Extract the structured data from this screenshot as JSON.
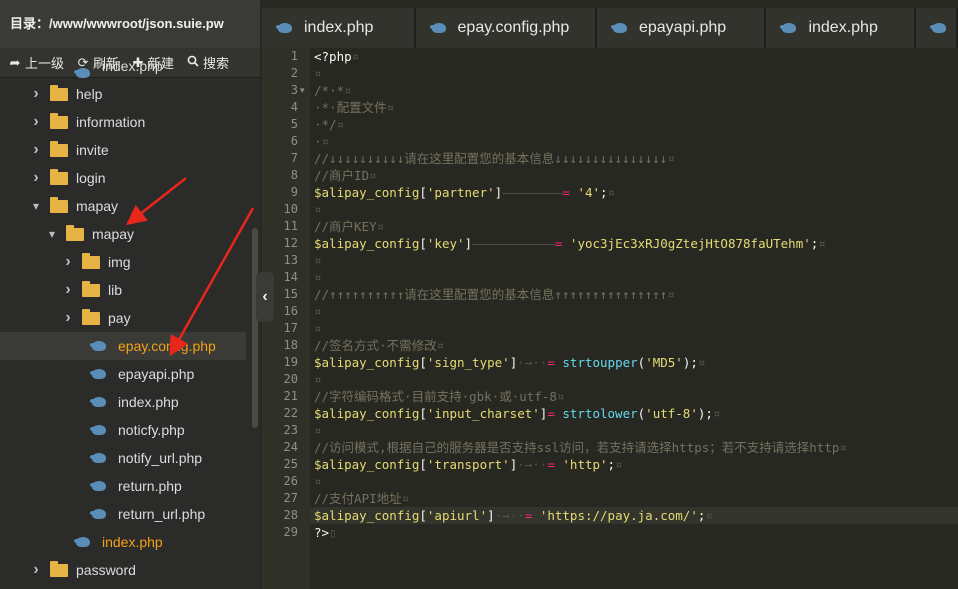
{
  "sidebar": {
    "title": "目录：/www/wwwroot/json.suie.pw",
    "toolbar": [
      {
        "label": "上一级",
        "icon": "arrow-up-icon"
      },
      {
        "label": "刷新",
        "icon": "refresh-icon"
      },
      {
        "label": "新建",
        "icon": "plus-icon"
      },
      {
        "label": "搜索",
        "icon": "search-icon"
      }
    ],
    "tree": [
      {
        "label": "index.php",
        "type": "file",
        "depth": 1,
        "state": "none"
      },
      {
        "label": "help",
        "type": "folder",
        "depth": 0,
        "state": "collapsed"
      },
      {
        "label": "information",
        "type": "folder",
        "depth": 0,
        "state": "collapsed"
      },
      {
        "label": "invite",
        "type": "folder",
        "depth": 0,
        "state": "collapsed"
      },
      {
        "label": "login",
        "type": "folder",
        "depth": 0,
        "state": "collapsed"
      },
      {
        "label": "mapay",
        "type": "folder",
        "depth": 0,
        "state": "expanded"
      },
      {
        "label": "mapay",
        "type": "folder",
        "depth": 1,
        "state": "expanded"
      },
      {
        "label": "img",
        "type": "folder",
        "depth": 2,
        "state": "collapsed"
      },
      {
        "label": "lib",
        "type": "folder",
        "depth": 2,
        "state": "collapsed"
      },
      {
        "label": "pay",
        "type": "folder",
        "depth": 2,
        "state": "collapsed"
      },
      {
        "label": "epay.config.php",
        "type": "file",
        "depth": 2,
        "state": "selected"
      },
      {
        "label": "epayapi.php",
        "type": "file",
        "depth": 2,
        "state": "none"
      },
      {
        "label": "index.php",
        "type": "file",
        "depth": 2,
        "state": "none"
      },
      {
        "label": "noticfy.php",
        "type": "file",
        "depth": 2,
        "state": "none"
      },
      {
        "label": "notify_url.php",
        "type": "file",
        "depth": 2,
        "state": "none"
      },
      {
        "label": "return.php",
        "type": "file",
        "depth": 2,
        "state": "none"
      },
      {
        "label": "return_url.php",
        "type": "file",
        "depth": 2,
        "state": "none"
      },
      {
        "label": "index.php",
        "type": "file",
        "depth": 1,
        "state": "active"
      },
      {
        "label": "password",
        "type": "folder",
        "depth": 0,
        "state": "collapsed"
      }
    ],
    "collapse_glyph": "‹"
  },
  "tabs": [
    {
      "label": "index.php"
    },
    {
      "label": "epay.config.php"
    },
    {
      "label": "epayapi.php"
    },
    {
      "label": "index.php"
    },
    {
      "label": ""
    }
  ],
  "editor": {
    "active_line": 28,
    "lines": [
      [
        [
          "kw",
          "<?php"
        ],
        [
          "inv",
          "¤"
        ]
      ],
      [
        [
          "inv",
          "¤"
        ]
      ],
      [
        [
          "cm",
          "/*·*"
        ],
        [
          "inv",
          "¤"
        ]
      ],
      [
        [
          "cm",
          "·*·配置文件"
        ],
        [
          "inv",
          "¤"
        ]
      ],
      [
        [
          "cm",
          "·*/"
        ],
        [
          "inv",
          "¤"
        ]
      ],
      [
        [
          "cm",
          "·"
        ],
        [
          "inv",
          "¤"
        ]
      ],
      [
        [
          "cm",
          "//↓↓↓↓↓↓↓↓↓↓请在这里配置您的基本信息↓↓↓↓↓↓↓↓↓↓↓↓↓↓↓"
        ],
        [
          "inv",
          "¤"
        ]
      ],
      [
        [
          "cm",
          "//商户ID"
        ],
        [
          "inv",
          "¤"
        ]
      ],
      [
        [
          "var",
          "$alipay_config"
        ],
        [
          "pun",
          "["
        ],
        [
          "str",
          "'partner'"
        ],
        [
          "pun",
          "]"
        ],
        [
          "inv",
          "————————"
        ],
        [
          "op",
          "="
        ],
        [
          "pun",
          " "
        ],
        [
          "str",
          "'4'"
        ],
        [
          "pun",
          ";"
        ],
        [
          "inv",
          "¤"
        ]
      ],
      [
        [
          "inv",
          "¤"
        ]
      ],
      [
        [
          "cm",
          "//商户KEY"
        ],
        [
          "inv",
          "¤"
        ]
      ],
      [
        [
          "var",
          "$alipay_config"
        ],
        [
          "pun",
          "["
        ],
        [
          "str",
          "'key'"
        ],
        [
          "pun",
          "]"
        ],
        [
          "inv",
          "———————————"
        ],
        [
          "op",
          "="
        ],
        [
          "pun",
          " "
        ],
        [
          "str",
          "'yoc3jEc3xRJ0gZtejHtO878faUTehm'"
        ],
        [
          "pun",
          ";"
        ],
        [
          "inv",
          "¤"
        ]
      ],
      [
        [
          "inv",
          "¤"
        ]
      ],
      [
        [
          "inv",
          "¤"
        ]
      ],
      [
        [
          "cm",
          "//↑↑↑↑↑↑↑↑↑↑请在这里配置您的基本信息↑↑↑↑↑↑↑↑↑↑↑↑↑↑↑"
        ],
        [
          "inv",
          "¤"
        ]
      ],
      [
        [
          "inv",
          "¤"
        ]
      ],
      [
        [
          "inv",
          "¤"
        ]
      ],
      [
        [
          "cm",
          "//签名方式·不需修改"
        ],
        [
          "inv",
          "¤"
        ]
      ],
      [
        [
          "var",
          "$alipay_config"
        ],
        [
          "pun",
          "["
        ],
        [
          "str",
          "'sign_type'"
        ],
        [
          "pun",
          "]"
        ],
        [
          "inv",
          "·→··"
        ],
        [
          "op",
          "="
        ],
        [
          "pun",
          " "
        ],
        [
          "fn",
          "strtoupper"
        ],
        [
          "pun",
          "("
        ],
        [
          "str",
          "'MD5'"
        ],
        [
          "pun",
          ");"
        ],
        [
          "inv",
          "¤"
        ]
      ],
      [
        [
          "inv",
          "¤"
        ]
      ],
      [
        [
          "cm",
          "//字符编码格式·目前支持·gbk·或·utf-8"
        ],
        [
          "inv",
          "¤"
        ]
      ],
      [
        [
          "var",
          "$alipay_config"
        ],
        [
          "pun",
          "["
        ],
        [
          "str",
          "'input_charset'"
        ],
        [
          "pun",
          "]"
        ],
        [
          "op",
          "="
        ],
        [
          "pun",
          " "
        ],
        [
          "fn",
          "strtolower"
        ],
        [
          "pun",
          "("
        ],
        [
          "str",
          "'utf-8'"
        ],
        [
          "pun",
          ");"
        ],
        [
          "inv",
          "¤"
        ]
      ],
      [
        [
          "inv",
          "¤"
        ]
      ],
      [
        [
          "cm",
          "//访问模式,根据自己的服务器是否支持ssl访问，若支持请选择https；若不支持请选择http"
        ],
        [
          "inv",
          "¤"
        ]
      ],
      [
        [
          "var",
          "$alipay_config"
        ],
        [
          "pun",
          "["
        ],
        [
          "str",
          "'transport'"
        ],
        [
          "pun",
          "]"
        ],
        [
          "inv",
          "·→··"
        ],
        [
          "op",
          "="
        ],
        [
          "pun",
          " "
        ],
        [
          "str",
          "'http'"
        ],
        [
          "pun",
          ";"
        ],
        [
          "inv",
          "¤"
        ]
      ],
      [
        [
          "inv",
          "¤"
        ]
      ],
      [
        [
          "cm",
          "//支付API地址"
        ],
        [
          "inv",
          "¤"
        ]
      ],
      [
        [
          "var",
          "$alipay_config"
        ],
        [
          "pun",
          "["
        ],
        [
          "str",
          "'apiurl'"
        ],
        [
          "pun",
          "]"
        ],
        [
          "inv",
          "·→··"
        ],
        [
          "op",
          "="
        ],
        [
          "pun",
          " "
        ],
        [
          "str",
          "'https://pay.ja.com/'"
        ],
        [
          "pun",
          ";"
        ],
        [
          "inv",
          "¤"
        ]
      ],
      [
        [
          "kw",
          "?>"
        ],
        [
          "inv",
          "▯"
        ]
      ]
    ]
  },
  "colors": {
    "accent_selected": "#f4a11a",
    "annotation_arrow": "#e8261c"
  }
}
